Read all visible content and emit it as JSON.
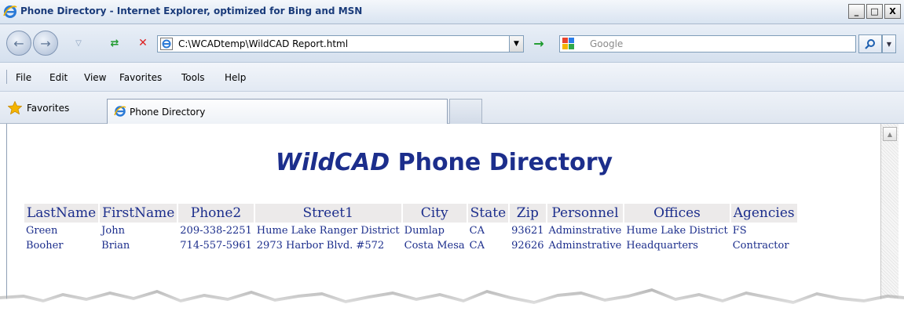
{
  "window": {
    "title": "Phone Directory - Internet Explorer, optimized for Bing and MSN",
    "controls": [
      "_",
      "□",
      "X"
    ]
  },
  "address_bar": {
    "url": "C:\\WCADtemp\\WildCAD Report.html",
    "search_placeholder": "Google"
  },
  "menu": {
    "items": [
      "File",
      "Edit",
      "View",
      "Favorites",
      "Tools",
      "Help"
    ]
  },
  "favorites_bar": {
    "favorites_label": "Favorites",
    "tab_label": "Phone Directory"
  },
  "page": {
    "heading_brand": "WildCAD",
    "heading_rest": " Phone Directory",
    "columns": [
      "LastName",
      "FirstName",
      "Phone2",
      "Street1",
      "City",
      "State",
      "Zip",
      "Personnel",
      "Offices",
      "Agencies"
    ],
    "rows": [
      [
        "Green",
        "John",
        "209-338-2251",
        "Hume Lake Ranger District",
        "Dumlap",
        "CA",
        "93621",
        "Adminstrative",
        "Hume Lake District",
        "FS"
      ],
      [
        "Booher",
        "Brian",
        "714-557-5961",
        "2973 Harbor Blvd. #572",
        "Costa Mesa",
        "CA",
        "92626",
        "Adminstrative",
        "Headquarters",
        "Contractor"
      ]
    ]
  },
  "colors": {
    "heading": "#1c2e8c",
    "header_cell_bg": "#eceaea"
  }
}
